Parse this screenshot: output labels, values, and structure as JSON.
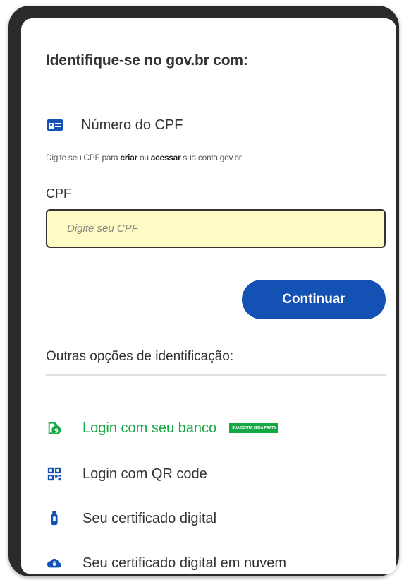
{
  "header": {
    "title": "Identifique-se no gov.br com:"
  },
  "cpf_section": {
    "icon": "id-card-icon",
    "label": "Número do CPF",
    "hint_prefix": "Digite seu CPF para ",
    "hint_create": "criar",
    "hint_or": " ou ",
    "hint_access": "acessar",
    "hint_suffix": " sua conta gov.br",
    "field_label": "CPF",
    "placeholder": "Digite seu CPF",
    "value": ""
  },
  "actions": {
    "continue_label": "Continuar"
  },
  "other_options": {
    "title": "Outras opções de identificação:",
    "items": [
      {
        "label": "Login com seu banco",
        "icon": "bank-icon",
        "badge": "SUA CONTA SERÁ PRATA"
      },
      {
        "label": "Login com QR code",
        "icon": "qr-code-icon"
      },
      {
        "label": "Seu certificado digital",
        "icon": "usb-token-icon"
      },
      {
        "label": "Seu certificado digital em nuvem",
        "icon": "cloud-lock-icon"
      }
    ]
  },
  "colors": {
    "primary": "#1451b4",
    "bank_green": "#15a744",
    "input_background": "#fefbc4",
    "text": "#333333"
  }
}
